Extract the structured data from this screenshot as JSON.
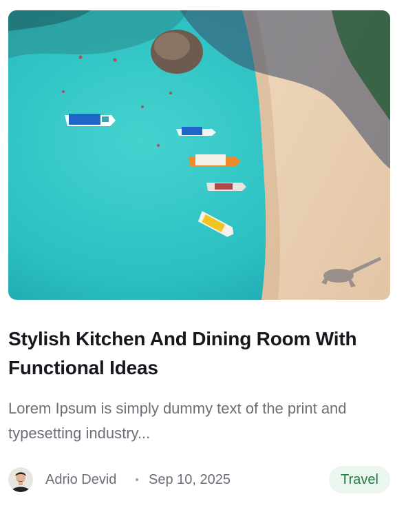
{
  "post": {
    "image_alt": "Aerial view of boats on turquoise water beside a sandy beach",
    "title": "Stylish Kitchen And Dining Room With Functional Ideas",
    "excerpt": "Lorem Ipsum is simply dummy text of the print and typesetting industry...",
    "author": "Adrio Devid",
    "date": "Sep 10, 2025",
    "category": "Travel"
  },
  "colors": {
    "accent_tag_bg": "#eaf6ee",
    "accent_tag_text": "#1e7a40",
    "title": "#16181d",
    "muted_text": "#6b6f78"
  }
}
